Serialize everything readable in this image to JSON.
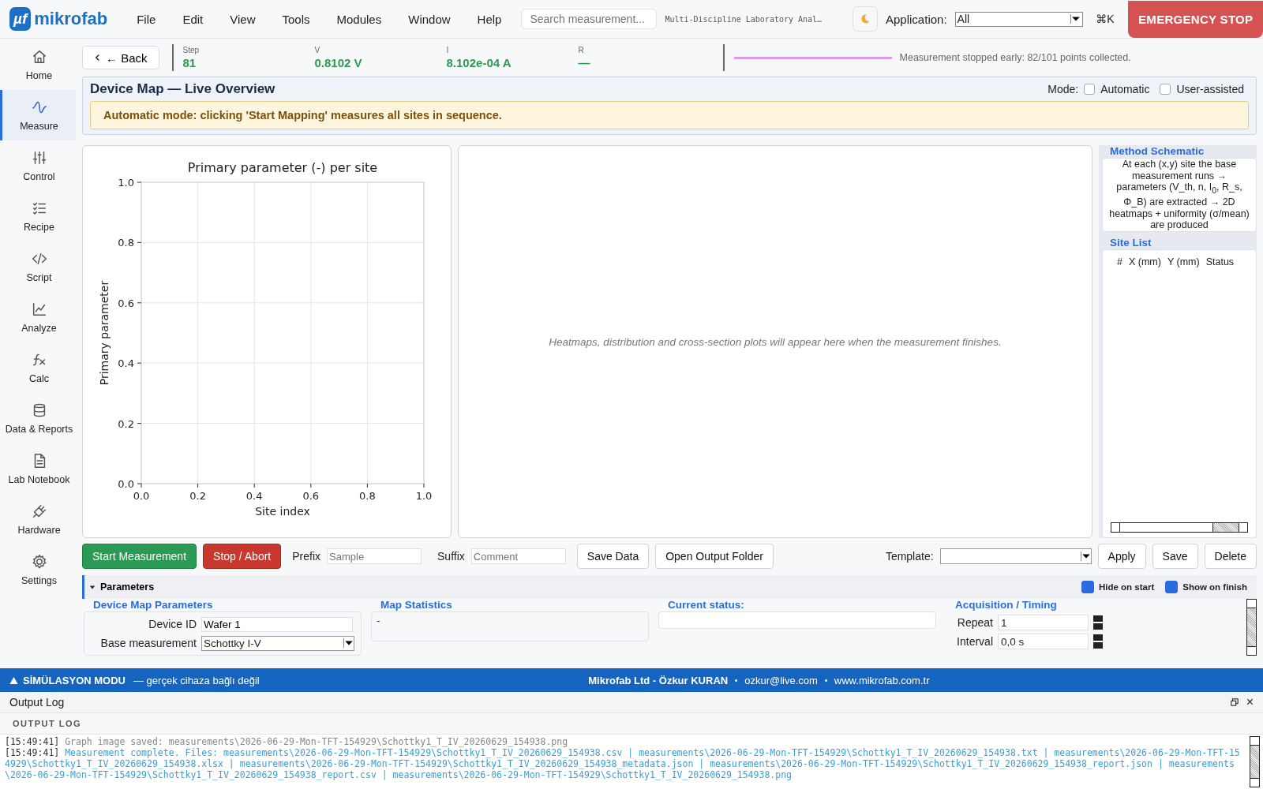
{
  "topbar": {
    "logo_mark": "µf",
    "logo_text": "mikrofab",
    "menu": [
      "File",
      "Edit",
      "View",
      "Tools",
      "Modules",
      "Window",
      "Help"
    ],
    "search": {
      "placeholder": "Search measurement..."
    },
    "subtitle": "Multi-Discipline Laboratory Anal…",
    "application": {
      "label": "Application:",
      "value": "All"
    },
    "shortcut": "⌘K",
    "emergency": "EMERGENCY STOP"
  },
  "sidebar": {
    "items": [
      {
        "label": "Home",
        "selected": false
      },
      {
        "label": "Measure",
        "selected": true
      },
      {
        "label": "Control",
        "selected": false
      },
      {
        "label": "Recipe",
        "selected": false
      },
      {
        "label": "Script",
        "selected": false
      },
      {
        "label": "Analyze",
        "selected": false
      },
      {
        "label": "Calc",
        "selected": false
      },
      {
        "label": "Data & Reports",
        "selected": false
      },
      {
        "label": "Lab Notebook",
        "selected": false
      },
      {
        "label": "Hardware",
        "selected": false
      },
      {
        "label": "Settings",
        "selected": false
      }
    ]
  },
  "status": {
    "back": "← Back",
    "readouts": [
      {
        "label": "Step",
        "value": "81"
      },
      {
        "label": "V",
        "value": "0.8102 V"
      },
      {
        "label": "I",
        "value": "8.102e-04 A"
      },
      {
        "label": "R",
        "value": "—"
      }
    ],
    "progress": {
      "level": 1
    },
    "message": "Measurement stopped early: 82/101 points collected."
  },
  "device_map": {
    "title": "Device Map — Live Overview",
    "mode_label": "Mode:",
    "modes": [
      {
        "label": "Automatic",
        "checked": false
      },
      {
        "label": "User-assisted",
        "checked": false
      }
    ],
    "notice": "Automatic mode: clicking 'Start Mapping' measures all sites in sequence."
  },
  "chart": {
    "chart_data": {
      "type": "scatter",
      "title": "Primary parameter (-) per site",
      "xlabel": "Site index",
      "ylabel": "Primary parameter",
      "xlim": [
        0,
        1
      ],
      "ylim": [
        0,
        1
      ],
      "grid": true,
      "xticks": [
        {
          "value": 0,
          "label": "0.0"
        },
        {
          "value": 0.2,
          "label": "0.2"
        },
        {
          "value": 0.4,
          "label": "0.4"
        },
        {
          "value": 0.6,
          "label": "0.6"
        },
        {
          "value": 0.8,
          "label": "0.8"
        },
        {
          "value": 1,
          "label": "1.0"
        }
      ],
      "yticks": [
        {
          "value": 0,
          "label": "0.0"
        },
        {
          "value": 0.2,
          "label": "0.2"
        },
        {
          "value": 0.4,
          "label": "0.4"
        },
        {
          "value": 0.6,
          "label": "0.6"
        },
        {
          "value": 0.8,
          "label": "0.8"
        },
        {
          "value": 1,
          "label": "1.0"
        }
      ]
    }
  },
  "results_placeholder": "Heatmaps, distribution and cross-section plots will appear here when the measurement finishes.",
  "method_schematic": {
    "title": "Method Schematic",
    "text": "At each (x,y) site the base measurement runs → parameters (V_th, n, I$_{0}$, R_s, Φ_B) are extracted → 2D heatmaps + uniformity (σ/mean) are produced"
  },
  "site_list": {
    "title": "Site List",
    "columns": [
      "#",
      "X (mm)",
      "Y (mm)",
      "Status"
    ]
  },
  "controls": {
    "start": "Start Measurement",
    "stop": "Stop / Abort",
    "prefix": {
      "label": "Prefix",
      "placeholder": "Sample"
    },
    "suffix": {
      "label": "Suffix",
      "placeholder": "Comment"
    },
    "buttons": [
      "Save Data",
      "Open Output Folder"
    ],
    "template": {
      "label": "Template:"
    },
    "template_buttons": [
      "Apply",
      "Save",
      "Delete"
    ]
  },
  "parameters": {
    "title": "Parameters",
    "expanded": true,
    "options": [
      {
        "label": "Hide on start",
        "checked": true
      },
      {
        "label": "Show on finish",
        "checked": true
      }
    ],
    "device_map_parameters": {
      "title": "Device Map Parameters",
      "fields": [
        {
          "label": "Device ID",
          "value": "Wafer 1",
          "kind": "text"
        },
        {
          "label": "Base measurement",
          "value": "Schottky I-V",
          "kind": "select"
        }
      ]
    },
    "map_statistics": {
      "title": "Map Statistics",
      "value": "-"
    },
    "current_status": {
      "title": "Current status:"
    },
    "acquisition": {
      "title": "Acquisition / Timing",
      "fields": [
        {
          "label": "Repeat",
          "value": "1"
        },
        {
          "label": "Interval",
          "value": "0,0 s"
        }
      ]
    }
  },
  "footer": {
    "mode": "SİMÜLASYON MODU",
    "mode_note": "— gerçek cihaza bağlı değil",
    "company": "Mikrofab Ltd - Özkur KURAN",
    "email": "ozkur@live.com",
    "website": "www.mikrofab.com.tr"
  },
  "output_log": {
    "window_title": "Output Log",
    "close": "×",
    "header": "OUTPUT LOG",
    "lines": [
      {
        "time": "[15:49:41]",
        "text": "Graph image saved: measurements\\2026-06-29-Mon-TFT-154929\\Schottky1_T_IV_20260629_154938.png",
        "kind": "info"
      },
      {
        "time": "[15:49:41]",
        "text": "Measurement complete. Files: measurements\\2026-06-29-Mon-TFT-154929\\Schottky1_T_IV_20260629_154938.csv | measurements\\2026-06-29-Mon-TFT-154929\\Schottky1_T_IV_20260629_154938.txt | measurements\\2026-06-29-Mon-TFT-154929\\Schottky1_T_IV_20260629_154938.xlsx | measurements\\2026-06-29-Mon-TFT-154929\\Schottky1_T_IV_20260629_154938_metadata.json | measurements\\2026-06-29-Mon-TFT-154929\\Schottky1_T_IV_20260629_154938_report.json | measurements\\2026-06-29-Mon-TFT-154929\\Schottky1_T_IV_20260629_154938_report.csv | measurements\\2026-06-29-Mon-TFT-154929\\Schottky1_T_IV_20260629_154938.png",
        "kind": "success"
      }
    ]
  }
}
